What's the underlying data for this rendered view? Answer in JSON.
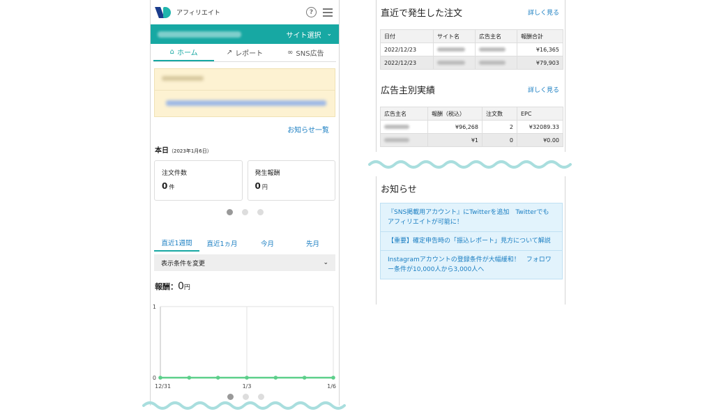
{
  "app": {
    "name": "アフィリエイト",
    "site_select_label": "サイト選択"
  },
  "nav": {
    "tabs": [
      {
        "label": "ホーム"
      },
      {
        "label": "レポート"
      },
      {
        "label": "SNS広告"
      }
    ]
  },
  "notice": {
    "list_link": "お知らせ一覧"
  },
  "today": {
    "label": "本日",
    "date": "（2023年1月6日）",
    "cards": [
      {
        "label": "注文件数",
        "value": "0",
        "unit": "件"
      },
      {
        "label": "発生報酬",
        "value": "0",
        "unit": "円"
      }
    ]
  },
  "period_tabs": [
    {
      "label": "直近1週間"
    },
    {
      "label": "直近1ヵ月"
    },
    {
      "label": "今月"
    },
    {
      "label": "先月"
    }
  ],
  "filter": {
    "label": "表示条件を変更"
  },
  "reward": {
    "label": "報酬：",
    "value": "0",
    "unit": "円"
  },
  "chart_data": {
    "type": "line",
    "x": [
      "12/31",
      "1/1",
      "1/2",
      "1/3",
      "1/4",
      "1/5",
      "1/6"
    ],
    "series": [
      {
        "values": [
          0,
          0,
          0,
          0,
          0,
          0,
          0
        ]
      }
    ],
    "tick_labels_x": [
      "12/31",
      "1/3",
      "1/6"
    ],
    "ylim": [
      0,
      1
    ],
    "yticks": [
      "0",
      "1"
    ],
    "line_color": "#5ccf8a"
  },
  "recent_orders": {
    "title": "直近で発生した注文",
    "more": "詳しく見る",
    "headers": [
      "日付",
      "サイト名",
      "広告主名",
      "報酬合計"
    ],
    "rows": [
      {
        "date": "2022/12/23",
        "amount": "¥16,365"
      },
      {
        "date": "2022/12/23",
        "amount": "¥79,903"
      }
    ]
  },
  "advertiser_results": {
    "title": "広告主別実績",
    "more": "詳しく見る",
    "headers": [
      "広告主名",
      "報酬（税込）",
      "注文数",
      "EPC"
    ],
    "rows": [
      {
        "reward": "¥96,268",
        "orders": "2",
        "epc": "¥32089.33"
      },
      {
        "reward": "¥1",
        "orders": "0",
        "epc": "¥0.00"
      }
    ]
  },
  "news": {
    "title": "お知らせ",
    "items": [
      "『SNS掲載用アカウント』にTwitterを追加　Twitterでもアフィリエイトが可能に！",
      "【重要】確定申告時の「振込レポート」見方について解説",
      "Instagramアカウントの登録条件が大幅緩和！　フォロワー条件が10,000人から3,000人へ"
    ]
  },
  "colors": {
    "accent": "#17a8a3",
    "link": "#1a7ec2",
    "notice_bg": "#fdf2d2",
    "news_bg": "#e2f3fc",
    "wave": "#a9dede"
  }
}
